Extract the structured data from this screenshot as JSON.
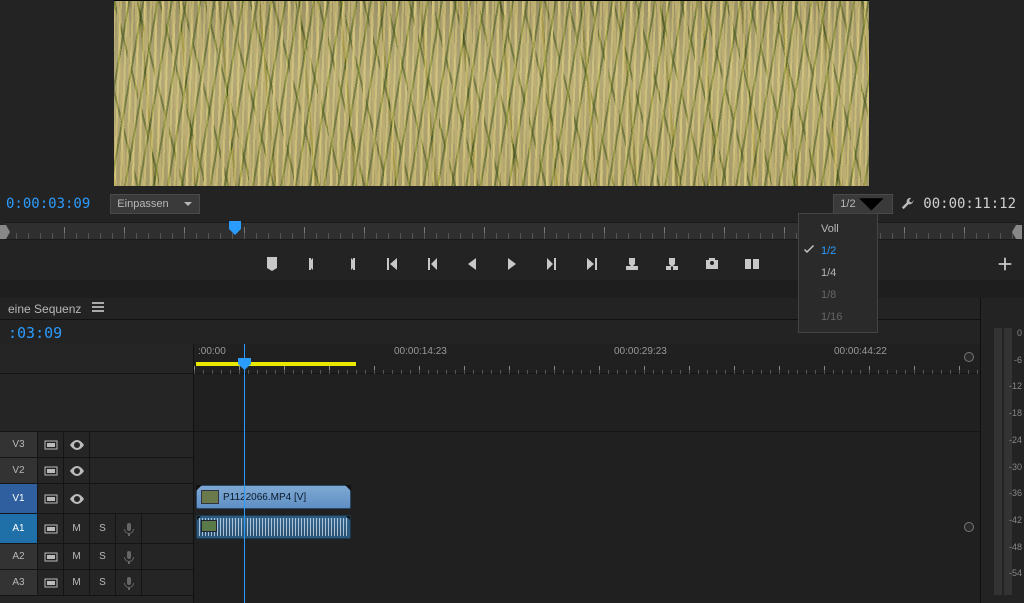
{
  "monitor": {
    "tc_left": "0:00:03:09",
    "tc_right": "00:00:11:12",
    "zoom_label": "Einpassen",
    "resolution_selected": "1/2",
    "resolution_menu": {
      "items": [
        {
          "label": "Voll",
          "selected": false,
          "disabled": false
        },
        {
          "label": "1/2",
          "selected": true,
          "disabled": false
        },
        {
          "label": "1/4",
          "selected": false,
          "disabled": false
        },
        {
          "label": "1/8",
          "selected": false,
          "disabled": true
        },
        {
          "label": "1/16",
          "selected": false,
          "disabled": true
        }
      ]
    }
  },
  "timeline": {
    "panel_title": "eine Sequenz",
    "tc": ":03:09",
    "ruler_labels": [
      ":00:00",
      "00:00:14:23",
      "00:00:29:23",
      "00:00:44:22"
    ],
    "tracks": {
      "video": [
        {
          "name": "V3",
          "selected": false,
          "eye": true
        },
        {
          "name": "V2",
          "selected": false,
          "eye": true
        },
        {
          "name": "V1",
          "selected": true,
          "eye": true
        }
      ],
      "audio": [
        {
          "name": "A1",
          "selected": true,
          "mute": "M",
          "solo": "S"
        },
        {
          "name": "A2",
          "selected": false,
          "mute": "M",
          "solo": "S"
        },
        {
          "name": "A3",
          "selected": false,
          "mute": "M",
          "solo": "S"
        }
      ]
    },
    "clip_name": "P1122066.MP4 [V]"
  },
  "meter": {
    "scale": [
      "0",
      "-6",
      "-12",
      "-18",
      "-24",
      "-30",
      "-36",
      "-42",
      "-48",
      "-54"
    ]
  }
}
